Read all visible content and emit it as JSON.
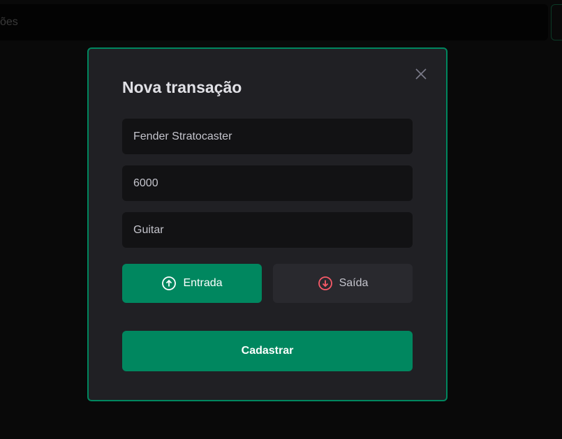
{
  "background": {
    "search_placeholder_fragment": "ões"
  },
  "modal": {
    "title": "Nova transação",
    "close_icon": "close-icon",
    "fields": {
      "description": "Fender Stratocaster",
      "price": "6000",
      "category": "Guitar"
    },
    "types": {
      "income_label": "Entrada",
      "outcome_label": "Saída",
      "selected": "income"
    },
    "submit_label": "Cadastrar"
  },
  "colors": {
    "accent": "#00875f",
    "danger": "#f75a68",
    "modal_bg": "#202024",
    "input_bg": "#121214"
  }
}
